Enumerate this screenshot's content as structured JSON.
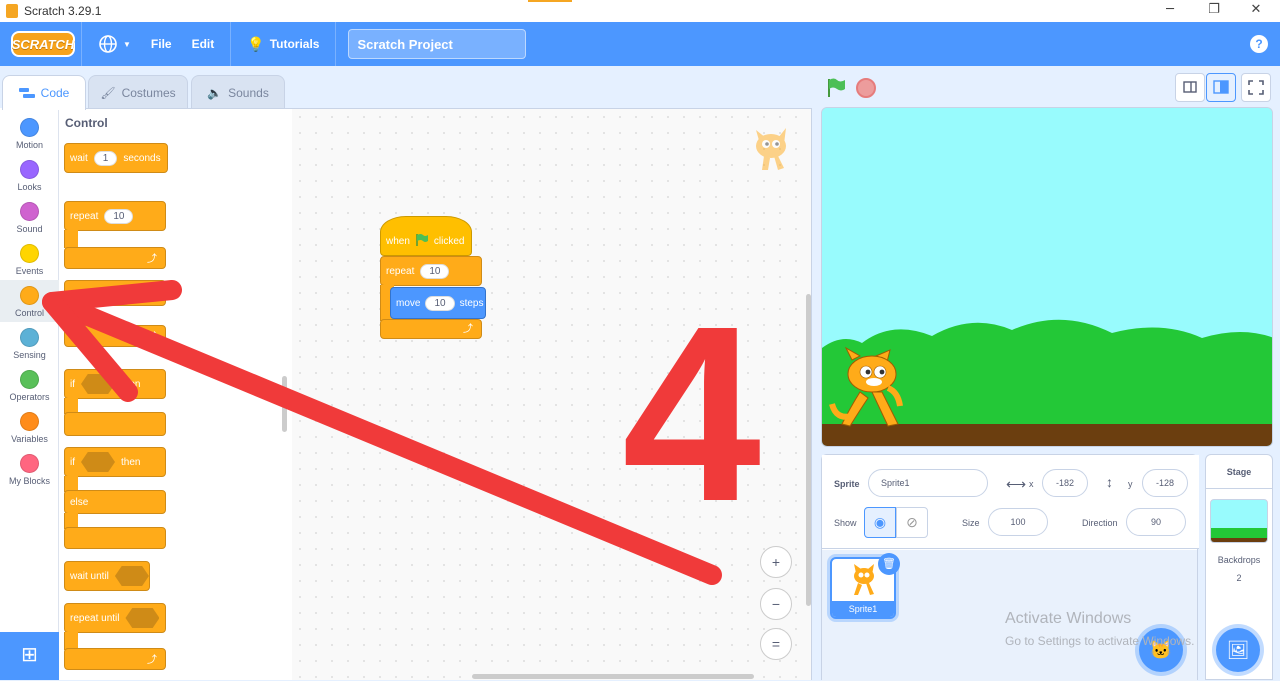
{
  "window": {
    "title": "Scratch 3.29.1",
    "min": "─",
    "max": "❐",
    "close": "✕"
  },
  "menubar": {
    "logo": "SCRATCH",
    "file": "File",
    "edit": "Edit",
    "tutorials": "Tutorials",
    "project_title": "Scratch Project",
    "help": "?"
  },
  "tabs": {
    "code": "Code",
    "costumes": "Costumes",
    "sounds": "Sounds"
  },
  "categories": [
    {
      "label": "Motion",
      "color": "#4c97ff"
    },
    {
      "label": "Looks",
      "color": "#9966ff"
    },
    {
      "label": "Sound",
      "color": "#cf63cf"
    },
    {
      "label": "Events",
      "color": "#ffd500"
    },
    {
      "label": "Control",
      "color": "#ffab19"
    },
    {
      "label": "Sensing",
      "color": "#5cb1d6"
    },
    {
      "label": "Operators",
      "color": "#59c059"
    },
    {
      "label": "Variables",
      "color": "#ff8c1a"
    },
    {
      "label": "My Blocks",
      "color": "#ff6680"
    }
  ],
  "palette": {
    "title": "Control",
    "wait": "wait",
    "wait_value": "1",
    "seconds": "seconds",
    "repeat": "repeat",
    "repeat_value": "10",
    "if": "if",
    "then": "then",
    "else": "else",
    "wait_until": "wait until",
    "repeat_until": "repeat until"
  },
  "script": {
    "when": "when",
    "clicked": "clicked",
    "repeat": "repeat",
    "repeat_value": "10",
    "move": "move",
    "move_value": "10",
    "steps": "steps"
  },
  "annotation": {
    "number": "4",
    "color": "#f03a3a"
  },
  "zoom": {
    "in": "+",
    "out": "−",
    "reset": "="
  },
  "sprite_info": {
    "sprite_label": "Sprite",
    "sprite_name": "Sprite1",
    "x_label": "x",
    "x": "-182",
    "y_label": "y",
    "y": "-128",
    "show_label": "Show",
    "size_label": "Size",
    "size": "100",
    "direction_label": "Direction",
    "direction": "90"
  },
  "sprite_list": [
    {
      "name": "Sprite1"
    }
  ],
  "stage_panel": {
    "title": "Stage",
    "backdrops_label": "Backdrops",
    "backdrops_count": "2"
  },
  "watermark": {
    "line1": "Activate Windows",
    "line2": "Go to Settings to activate Windows."
  }
}
